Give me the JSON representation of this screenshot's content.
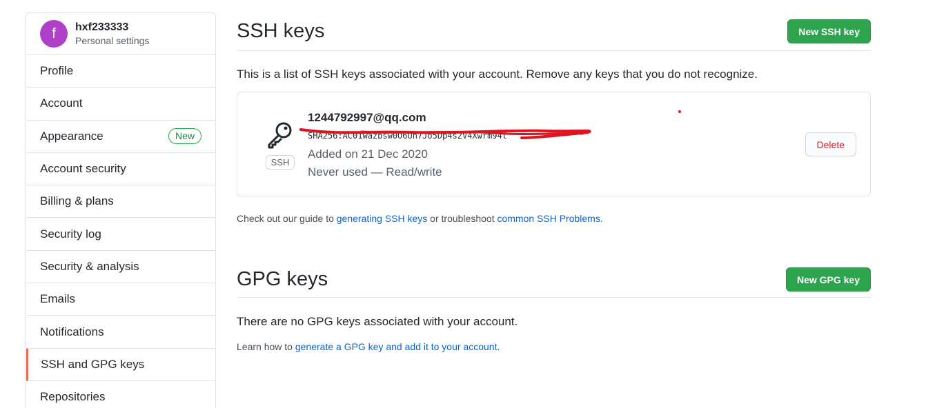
{
  "sidebar": {
    "user": {
      "avatar_letter": "f",
      "name": "hxf233333",
      "subtitle": "Personal settings"
    },
    "items": [
      {
        "label": "Profile"
      },
      {
        "label": "Account"
      },
      {
        "label": "Appearance",
        "badge": "New"
      },
      {
        "label": "Account security"
      },
      {
        "label": "Billing & plans"
      },
      {
        "label": "Security log"
      },
      {
        "label": "Security & analysis"
      },
      {
        "label": "Emails"
      },
      {
        "label": "Notifications"
      },
      {
        "label": "SSH and GPG keys",
        "selected": true
      },
      {
        "label": "Repositories"
      }
    ]
  },
  "ssh": {
    "title": "SSH keys",
    "new_button": "New SSH key",
    "intro": "This is a list of SSH keys associated with your account. Remove any keys that you do not recognize.",
    "key": {
      "icon": "key-icon",
      "type_label": "SSH",
      "title": "1244792997@qq.com",
      "fingerprint": "SHA256:AC01wazbsw0O6Un7Jo5Dp4s2V4Xwrm94t",
      "added": "Added on 21 Dec 2020",
      "usage": "Never used — Read/write",
      "delete_label": "Delete"
    },
    "guide": {
      "prefix": "Check out our guide to ",
      "link1": "generating SSH keys",
      "middle": " or troubleshoot ",
      "link2": "common SSH Problems",
      "suffix": "."
    }
  },
  "gpg": {
    "title": "GPG keys",
    "new_button": "New GPG key",
    "empty": "There are no GPG keys associated with your account.",
    "learn": {
      "prefix": "Learn how to ",
      "link": "generate a GPG key and add it to your account",
      "suffix": "."
    }
  },
  "colors": {
    "primary_green": "#2ea44f",
    "link_blue": "#0366d6",
    "danger_red": "#cb2431",
    "selected_marker": "#e36f59",
    "avatar_bg": "#b03fc9",
    "redaction_red": "#e0141e"
  }
}
